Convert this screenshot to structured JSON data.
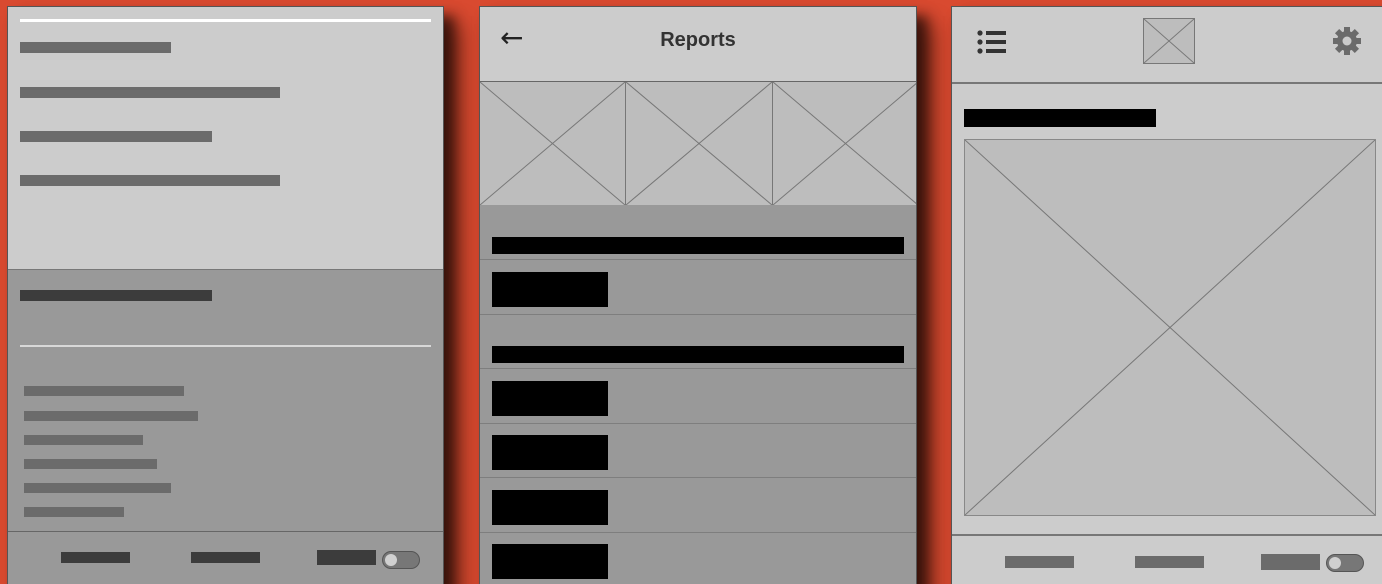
{
  "screens": {
    "reports": {
      "back_icon": "←",
      "title": "Reports"
    }
  },
  "icons": {
    "back": "arrow-left-icon",
    "menu": "list-icon",
    "settings": "gear-icon",
    "logo": "image-placeholder-icon"
  },
  "colors": {
    "background": "#d94a30",
    "panel_light": "#cccccc",
    "panel_mid": "#999999",
    "bar_dark": "#3c3c3c",
    "bar_mid": "#6b6b6b",
    "block": "#000000"
  }
}
